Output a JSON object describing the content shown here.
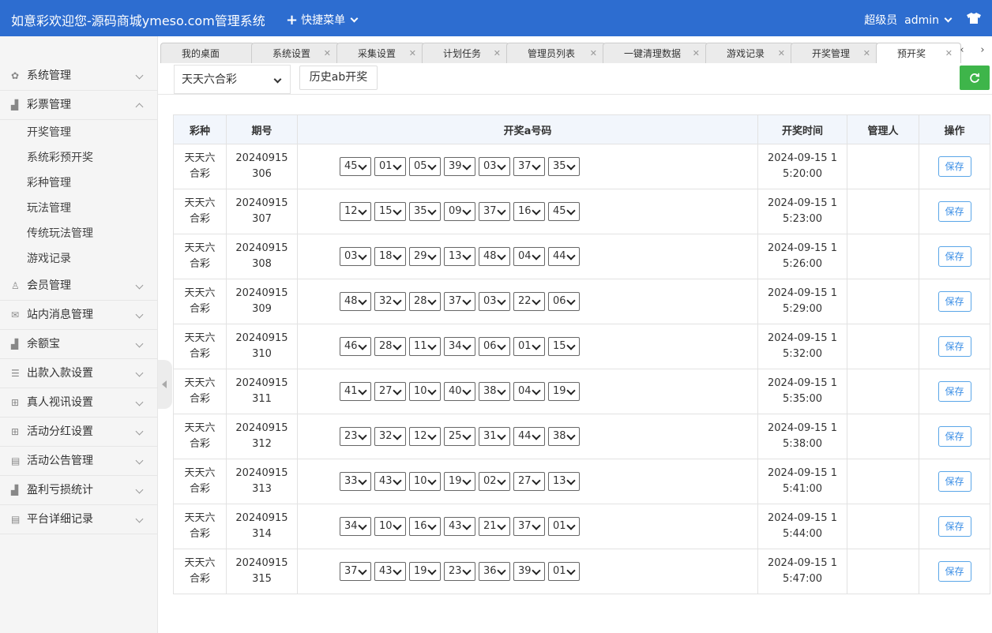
{
  "header": {
    "title": "如意彩欢迎您-源码商城ymeso.com管理系统",
    "quick_menu": "快捷菜单",
    "role": "超级员",
    "username": "admin"
  },
  "sidebar": {
    "items": [
      {
        "label": "系统管理",
        "icon": "gear-icon",
        "expanded": false
      },
      {
        "label": "彩票管理",
        "icon": "chart-icon",
        "expanded": true,
        "children": [
          "开奖管理",
          "系统彩预开奖",
          "彩种管理",
          "玩法管理",
          "传统玩法管理",
          "游戏记录"
        ]
      },
      {
        "label": "会员管理",
        "icon": "user-icon",
        "expanded": false
      },
      {
        "label": "站内消息管理",
        "icon": "mail-icon",
        "expanded": false
      },
      {
        "label": "余额宝",
        "icon": "chart-icon",
        "expanded": false
      },
      {
        "label": "出款入款设置",
        "icon": "list-icon",
        "expanded": false
      },
      {
        "label": "真人视讯设置",
        "icon": "gift-icon",
        "expanded": false
      },
      {
        "label": "活动分红设置",
        "icon": "gift-icon",
        "expanded": false
      },
      {
        "label": "活动公告管理",
        "icon": "doc-icon",
        "expanded": false
      },
      {
        "label": "盈利亏损统计",
        "icon": "chart-icon",
        "expanded": false
      },
      {
        "label": "平台详细记录",
        "icon": "doc-icon",
        "expanded": false
      }
    ]
  },
  "tabs": [
    "我的桌面",
    "系统设置",
    "采集设置",
    "计划任务",
    "管理员列表",
    "一键清理数据",
    "游戏记录",
    "开奖管理",
    "预开奖"
  ],
  "active_tab": "预开奖",
  "toolbar": {
    "lottery_select": "天天六合彩",
    "history_button": "历史ab开奖"
  },
  "table": {
    "headers": [
      "彩种",
      "期号",
      "开奖a号码",
      "开奖时间",
      "管理人",
      "操作"
    ],
    "save_label": "保存",
    "rows": [
      {
        "lottery": "天天六合彩",
        "issue": "20240915306",
        "numbers": [
          "45",
          "01",
          "05",
          "39",
          "03",
          "37",
          "35"
        ],
        "time": "2024-09-15 15:20:00",
        "admin": ""
      },
      {
        "lottery": "天天六合彩",
        "issue": "20240915307",
        "numbers": [
          "12",
          "15",
          "35",
          "09",
          "37",
          "16",
          "45"
        ],
        "time": "2024-09-15 15:23:00",
        "admin": ""
      },
      {
        "lottery": "天天六合彩",
        "issue": "20240915308",
        "numbers": [
          "03",
          "18",
          "29",
          "13",
          "48",
          "04",
          "44"
        ],
        "time": "2024-09-15 15:26:00",
        "admin": ""
      },
      {
        "lottery": "天天六合彩",
        "issue": "20240915309",
        "numbers": [
          "48",
          "32",
          "28",
          "37",
          "03",
          "22",
          "06"
        ],
        "time": "2024-09-15 15:29:00",
        "admin": ""
      },
      {
        "lottery": "天天六合彩",
        "issue": "20240915310",
        "numbers": [
          "46",
          "28",
          "11",
          "34",
          "06",
          "01",
          "15"
        ],
        "time": "2024-09-15 15:32:00",
        "admin": ""
      },
      {
        "lottery": "天天六合彩",
        "issue": "20240915311",
        "numbers": [
          "41",
          "27",
          "10",
          "40",
          "38",
          "04",
          "19"
        ],
        "time": "2024-09-15 15:35:00",
        "admin": ""
      },
      {
        "lottery": "天天六合彩",
        "issue": "20240915312",
        "numbers": [
          "23",
          "32",
          "12",
          "25",
          "31",
          "44",
          "38"
        ],
        "time": "2024-09-15 15:38:00",
        "admin": ""
      },
      {
        "lottery": "天天六合彩",
        "issue": "20240915313",
        "numbers": [
          "33",
          "43",
          "10",
          "19",
          "02",
          "27",
          "13"
        ],
        "time": "2024-09-15 15:41:00",
        "admin": ""
      },
      {
        "lottery": "天天六合彩",
        "issue": "20240915314",
        "numbers": [
          "34",
          "10",
          "16",
          "43",
          "21",
          "37",
          "01"
        ],
        "time": "2024-09-15 15:44:00",
        "admin": ""
      },
      {
        "lottery": "天天六合彩",
        "issue": "20240915315",
        "numbers": [
          "37",
          "43",
          "19",
          "23",
          "36",
          "39",
          "01"
        ],
        "time": "2024-09-15 15:47:00",
        "admin": ""
      }
    ]
  }
}
